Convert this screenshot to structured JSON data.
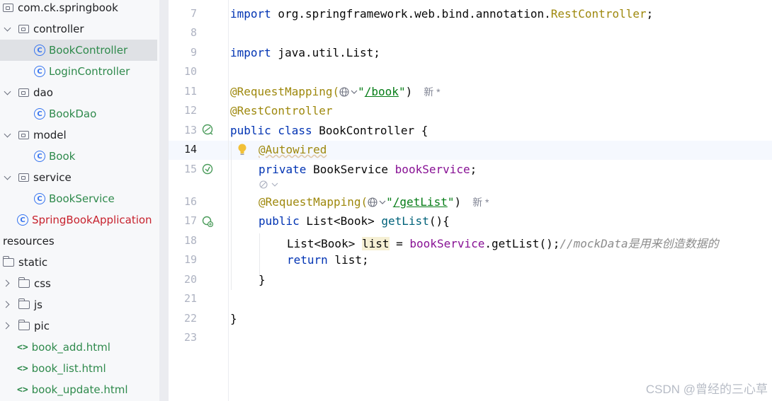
{
  "tree": {
    "items": [
      {
        "label": "com.ck.springbook",
        "icon": "package-icon",
        "chevron": "none",
        "color": "default",
        "selected": false
      },
      {
        "label": "controller",
        "icon": "package-icon",
        "chevron": "down",
        "color": "default",
        "selected": false
      },
      {
        "label": "BookController",
        "icon": "class-icon",
        "chevron": "none",
        "color": "green",
        "selected": true
      },
      {
        "label": "LoginController",
        "icon": "class-icon",
        "chevron": "none",
        "color": "green",
        "selected": false
      },
      {
        "label": "dao",
        "icon": "package-icon",
        "chevron": "down",
        "color": "default",
        "selected": false
      },
      {
        "label": "BookDao",
        "icon": "class-icon",
        "chevron": "none",
        "color": "green",
        "selected": false
      },
      {
        "label": "model",
        "icon": "package-icon",
        "chevron": "down",
        "color": "default",
        "selected": false
      },
      {
        "label": "Book",
        "icon": "class-icon",
        "chevron": "none",
        "color": "green",
        "selected": false
      },
      {
        "label": "service",
        "icon": "package-icon",
        "chevron": "down",
        "color": "default",
        "selected": false
      },
      {
        "label": "BookService",
        "icon": "class-icon",
        "chevron": "none",
        "color": "green",
        "selected": false
      },
      {
        "label": "SpringBookApplication",
        "icon": "spring-boot-class-icon",
        "chevron": "none",
        "color": "red",
        "selected": false
      },
      {
        "label": "resources",
        "icon": "none",
        "chevron": "none",
        "color": "default",
        "selected": false
      },
      {
        "label": "static",
        "icon": "folder-icon",
        "chevron": "none",
        "color": "default",
        "selected": false
      },
      {
        "label": "css",
        "icon": "folder-icon",
        "chevron": "right",
        "color": "default",
        "selected": false
      },
      {
        "label": "js",
        "icon": "folder-icon",
        "chevron": "right",
        "color": "default",
        "selected": false
      },
      {
        "label": "pic",
        "icon": "folder-icon",
        "chevron": "right",
        "color": "default",
        "selected": false
      },
      {
        "label": "book_add.html",
        "icon": "html-icon",
        "chevron": "none",
        "color": "green",
        "selected": false
      },
      {
        "label": "book_list.html",
        "icon": "html-icon",
        "chevron": "none",
        "color": "green",
        "selected": false
      },
      {
        "label": "book_update.html",
        "icon": "html-icon",
        "chevron": "none",
        "color": "green",
        "selected": false
      }
    ]
  },
  "editor": {
    "line_numbers": [
      "7",
      "8",
      "9",
      "10",
      "11",
      "12",
      "13",
      "14",
      "15",
      "16",
      "17",
      "18",
      "19",
      "20",
      "21",
      "22",
      "23"
    ],
    "active_line": "14",
    "code": {
      "l7_import": "import",
      "l7_pkg": " org.springframework.web.bind.annotation.",
      "l7_cls": "RestController",
      "l7_semi": ";",
      "l9_import": "import",
      "l9_rest": " java.util.List;",
      "l11_ann": "@RequestMapping(",
      "l11_q1": "\"",
      "l11_path": "/book",
      "l11_q2": "\"",
      "l11_close": ")",
      "l11_hint": "新 *",
      "l12_ann": "@RestController",
      "l13_kw": "public class",
      "l13_rest": " BookController {",
      "l14_ann": "@Autowired",
      "l15_kw": "private",
      "l15_type": " BookService ",
      "l15_field": "bookService",
      "l15_semi": ";",
      "l16_ann": "@RequestMapping(",
      "l16_q1": "\"",
      "l16_path": "/getList",
      "l16_q2": "\"",
      "l16_close": ")",
      "l16_hint": "新 *",
      "l17_kw": "public",
      "l17_type": " List<Book> ",
      "l17_method": "getList",
      "l17_rest": "(){",
      "l18_type": "List<Book> ",
      "l18_var": "list",
      "l18_eq": " = ",
      "l18_field": "bookService",
      "l18_call": ".getList();",
      "l18_comment": "//mockData是用来创造数据的",
      "l19_kw": "return",
      "l19_rest": " list;",
      "l20_brace": "}",
      "l22_brace": "}"
    }
  },
  "watermark": "CSDN @曾经的三心草"
}
